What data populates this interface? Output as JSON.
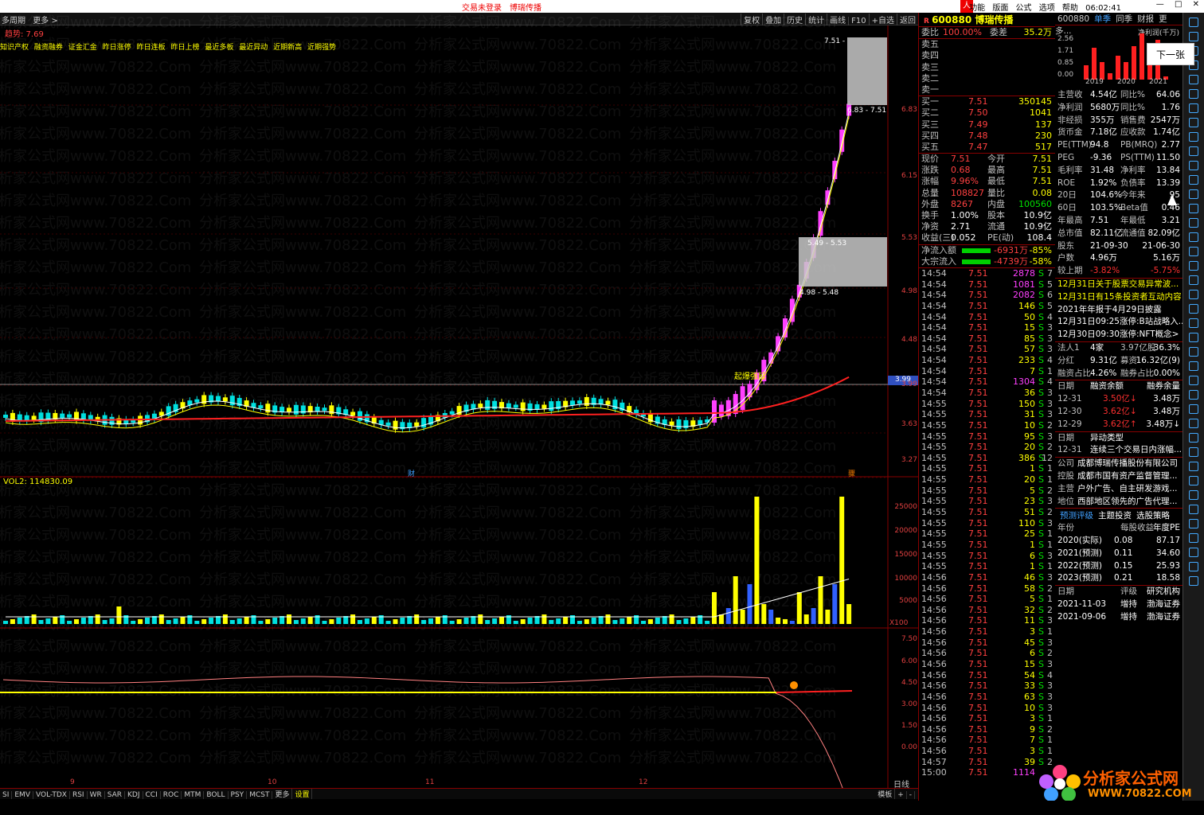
{
  "topbar": {
    "status": "交易未登录",
    "stock_name": "博瑞传播",
    "menu": [
      "功能",
      "版面",
      "公式",
      "选项",
      "帮助"
    ],
    "time": "06:02:41",
    "win_min": "—",
    "win_max": "□",
    "win_close": "✕"
  },
  "menurow": {
    "items": [
      "多周期",
      "更多 >"
    ],
    "trend_label": "趋势: 7.69",
    "tools": [
      "复权",
      "叠加",
      "历史",
      "统计",
      "画线",
      "F10",
      "+自选",
      "返回"
    ]
  },
  "tags": [
    "知识产权",
    "融资融券",
    "证金汇金",
    "昨日涨停",
    "昨日连板",
    "昨日上榜",
    "最近多板",
    "最近异动",
    "近期新高",
    "近期强势"
  ],
  "chart_labels": {
    "gap1": "7.51 -",
    "gap2": "6.83 - 7.51",
    "gap3": "5.49 - 5.53",
    "gap4": "4.98 - 5.48",
    "signal": "起爆强延",
    "cursor_price": "3.99",
    "vol_label": "VOL2: 114830.09",
    "x100": "X100",
    "finance_mark": "财",
    "news_mark": "骤",
    "dayline": "日线"
  },
  "price_axis": [
    "6.83",
    "6.15",
    "5.53",
    "4.98",
    "4.48",
    "3.99",
    "3.63",
    "3.27"
  ],
  "vol_axis": [
    "25000",
    "20000",
    "15000",
    "10000",
    "5000"
  ],
  "ind_axis": [
    "7.50",
    "6.00",
    "4.50",
    "3.00",
    "1.50",
    "0.00"
  ],
  "months": [
    "9",
    "10",
    "11",
    "12"
  ],
  "bottom_tabs": [
    "SI",
    "EMV",
    "VOL-TDX",
    "RSI",
    "WR",
    "SAR",
    "KDJ",
    "CCI",
    "ROC",
    "MTM",
    "BOLL",
    "PSY",
    "MCST",
    "更多",
    "设置"
  ],
  "bottom_right": [
    "模板",
    "+",
    "-"
  ],
  "quote": {
    "code": "600880",
    "name": "博瑞传播",
    "weibi": {
      "label": "委比",
      "value": "100.00%",
      "label2": "委差",
      "value2": "35.2万"
    },
    "sell": [
      {
        "l": "卖五",
        "p": "",
        "v": ""
      },
      {
        "l": "卖四",
        "p": "",
        "v": ""
      },
      {
        "l": "卖三",
        "p": "",
        "v": ""
      },
      {
        "l": "卖二",
        "p": "",
        "v": ""
      },
      {
        "l": "卖一",
        "p": "",
        "v": ""
      }
    ],
    "buy": [
      {
        "l": "买一",
        "p": "7.51",
        "v": "350145"
      },
      {
        "l": "买二",
        "p": "7.50",
        "v": "1041"
      },
      {
        "l": "买三",
        "p": "7.49",
        "v": "137"
      },
      {
        "l": "买四",
        "p": "7.48",
        "v": "230"
      },
      {
        "l": "买五",
        "p": "7.47",
        "v": "517"
      }
    ],
    "stats": [
      {
        "a": "现价",
        "b": "7.51",
        "c": "今开",
        "d": "7.51"
      },
      {
        "a": "涨跌",
        "b": "0.68",
        "c": "最高",
        "d": "7.51"
      },
      {
        "a": "涨幅",
        "b": "9.96%",
        "c": "最低",
        "d": "7.51"
      },
      {
        "a": "总量",
        "b": "108827",
        "c": "量比",
        "d": "0.08"
      },
      {
        "a": "外盘",
        "b": "8267",
        "c": "内盘",
        "d": "100560"
      },
      {
        "a": "换手",
        "b": "1.00%",
        "c": "股本",
        "d": "10.9亿"
      },
      {
        "a": "净资",
        "b": "2.71",
        "c": "流通",
        "d": "10.9亿"
      },
      {
        "a": "收益(三)",
        "b": "0.052",
        "c": "PE(动)",
        "d": "108.4"
      }
    ],
    "flows": [
      {
        "a": "净流入额",
        "b": "-6931万",
        "c": "-85%"
      },
      {
        "a": "大宗流入",
        "b": "-4739万",
        "c": "-58%"
      }
    ],
    "ticks": [
      {
        "t": "14:54",
        "p": "7.51",
        "v": "2878",
        "s": "S",
        "n": "7"
      },
      {
        "t": "14:54",
        "p": "7.51",
        "v": "1081",
        "s": "S",
        "n": "5"
      },
      {
        "t": "14:54",
        "p": "7.51",
        "v": "2082",
        "s": "S",
        "n": "6"
      },
      {
        "t": "14:54",
        "p": "7.51",
        "v": "146",
        "s": "S",
        "n": "5"
      },
      {
        "t": "14:54",
        "p": "7.51",
        "v": "50",
        "s": "S",
        "n": "4"
      },
      {
        "t": "14:54",
        "p": "7.51",
        "v": "15",
        "s": "S",
        "n": "3"
      },
      {
        "t": "14:54",
        "p": "7.51",
        "v": "85",
        "s": "S",
        "n": "3"
      },
      {
        "t": "14:54",
        "p": "7.51",
        "v": "57",
        "s": "S",
        "n": "3"
      },
      {
        "t": "14:54",
        "p": "7.51",
        "v": "233",
        "s": "S",
        "n": "4"
      },
      {
        "t": "14:54",
        "p": "7.51",
        "v": "7",
        "s": "S",
        "n": "1"
      },
      {
        "t": "14:54",
        "p": "7.51",
        "v": "1304",
        "s": "S",
        "n": "4"
      },
      {
        "t": "14:54",
        "p": "7.51",
        "v": "36",
        "s": "S",
        "n": "3"
      },
      {
        "t": "14:55",
        "p": "7.51",
        "v": "150",
        "s": "S",
        "n": "3"
      },
      {
        "t": "14:55",
        "p": "7.51",
        "v": "31",
        "s": "S",
        "n": "3"
      },
      {
        "t": "14:55",
        "p": "7.51",
        "v": "10",
        "s": "S",
        "n": "2"
      },
      {
        "t": "14:55",
        "p": "7.51",
        "v": "95",
        "s": "S",
        "n": "3"
      },
      {
        "t": "14:55",
        "p": "7.51",
        "v": "20",
        "s": "S",
        "n": "2"
      },
      {
        "t": "14:55",
        "p": "7.51",
        "v": "386",
        "s": "S",
        "n": "12"
      },
      {
        "t": "14:55",
        "p": "7.51",
        "v": "1",
        "s": "S",
        "n": "1"
      },
      {
        "t": "14:55",
        "p": "7.51",
        "v": "20",
        "s": "S",
        "n": "1"
      },
      {
        "t": "14:55",
        "p": "7.51",
        "v": "5",
        "s": "S",
        "n": "2"
      },
      {
        "t": "14:55",
        "p": "7.51",
        "v": "23",
        "s": "S",
        "n": "3"
      },
      {
        "t": "14:55",
        "p": "7.51",
        "v": "51",
        "s": "S",
        "n": "2"
      },
      {
        "t": "14:55",
        "p": "7.51",
        "v": "110",
        "s": "S",
        "n": "3"
      },
      {
        "t": "14:55",
        "p": "7.51",
        "v": "25",
        "s": "S",
        "n": "1"
      },
      {
        "t": "14:55",
        "p": "7.51",
        "v": "1",
        "s": "S",
        "n": "1"
      },
      {
        "t": "14:55",
        "p": "7.51",
        "v": "6",
        "s": "S",
        "n": "3"
      },
      {
        "t": "14:55",
        "p": "7.51",
        "v": "1",
        "s": "S",
        "n": "1"
      },
      {
        "t": "14:56",
        "p": "7.51",
        "v": "46",
        "s": "S",
        "n": "3"
      },
      {
        "t": "14:56",
        "p": "7.51",
        "v": "58",
        "s": "S",
        "n": "2"
      },
      {
        "t": "14:56",
        "p": "7.51",
        "v": "5",
        "s": "S",
        "n": "1"
      },
      {
        "t": "14:56",
        "p": "7.51",
        "v": "32",
        "s": "S",
        "n": "2"
      },
      {
        "t": "14:56",
        "p": "7.51",
        "v": "11",
        "s": "S",
        "n": "3"
      },
      {
        "t": "14:56",
        "p": "7.51",
        "v": "3",
        "s": "S",
        "n": "1"
      },
      {
        "t": "14:56",
        "p": "7.51",
        "v": "45",
        "s": "S",
        "n": "3"
      },
      {
        "t": "14:56",
        "p": "7.51",
        "v": "6",
        "s": "S",
        "n": "2"
      },
      {
        "t": "14:56",
        "p": "7.51",
        "v": "15",
        "s": "S",
        "n": "3"
      },
      {
        "t": "14:56",
        "p": "7.51",
        "v": "54",
        "s": "S",
        "n": "4"
      },
      {
        "t": "14:56",
        "p": "7.51",
        "v": "33",
        "s": "S",
        "n": "3"
      },
      {
        "t": "14:56",
        "p": "7.51",
        "v": "63",
        "s": "S",
        "n": "3"
      },
      {
        "t": "14:56",
        "p": "7.51",
        "v": "10",
        "s": "S",
        "n": "3"
      },
      {
        "t": "14:56",
        "p": "7.51",
        "v": "3",
        "s": "S",
        "n": "1"
      },
      {
        "t": "14:56",
        "p": "7.51",
        "v": "9",
        "s": "S",
        "n": "2"
      },
      {
        "t": "14:56",
        "p": "7.51",
        "v": "7",
        "s": "S",
        "n": "1"
      },
      {
        "t": "14:56",
        "p": "7.51",
        "v": "3",
        "s": "S",
        "n": "1"
      },
      {
        "t": "14:57",
        "p": "7.51",
        "v": "39",
        "s": "S",
        "n": "2"
      },
      {
        "t": "15:00",
        "p": "7.51",
        "v": "1114",
        "s": "",
        "n": ""
      }
    ]
  },
  "fin": {
    "head": [
      "600880",
      "单季",
      "同季",
      "财报",
      "更多..."
    ],
    "chart_label": "净利润(千万)",
    "chart_y": [
      "2.56",
      "1.71",
      "0.85",
      "0.00"
    ],
    "chart_years": [
      "2019",
      "2020",
      "2021"
    ],
    "rows1": [
      {
        "a": "主营收",
        "b": "4.54亿",
        "c": "同比%",
        "d": "64.06"
      },
      {
        "a": "净利润",
        "b": "5680万",
        "c": "同比%",
        "d": "1.76"
      },
      {
        "a": "非经损",
        "b": "355万",
        "c": "销售费",
        "d": "2547万"
      },
      {
        "a": "货币金",
        "b": "7.18亿",
        "c": "应收款",
        "d": "1.74亿"
      },
      {
        "a": "PE(TTM)",
        "b": "94.8",
        "c": "PB(MRQ)",
        "d": "2.77"
      },
      {
        "a": "PEG",
        "b": "-9.36",
        "c": "PS(TTM)",
        "d": "11.50"
      },
      {
        "a": "毛利率",
        "b": "31.48",
        "c": "净利率",
        "d": "13.84"
      },
      {
        "a": "ROE",
        "b": "1.92%",
        "c": "负债率",
        "d": "13.39"
      },
      {
        "a": "20日",
        "b": "104.6%",
        "c": "今年来",
        "d": "95"
      },
      {
        "a": "60日",
        "b": "103.5%",
        "c": "Beta值",
        "d": "0.46"
      },
      {
        "a": "年最高",
        "b": "7.51",
        "c": "年最低",
        "d": "3.21"
      },
      {
        "a": "总市值",
        "b": "82.11亿",
        "c": "流通值",
        "d": "82.09亿"
      },
      {
        "a": "股东",
        "b": "21-09-30",
        "c": "",
        "d": "21-06-30"
      },
      {
        "a": "户数",
        "b": "4.96万",
        "c": "",
        "d": "5.16万"
      },
      {
        "a": "较上期",
        "b": "-3.82%",
        "c": "",
        "d": "-5.75%"
      }
    ],
    "news": [
      "12月31日关于股票交易异常波...",
      "12月31日有15条投资者互动内容",
      "2021年年报于4月29日披露",
      "12月31日09:25涨停:B站战略入...",
      "12月30日09:30涨停:NFT概念>"
    ],
    "holder": {
      "a": "法人1",
      "b": "4家",
      "c": "3.97亿股",
      "d": "36.3%"
    },
    "div": {
      "a": "分红",
      "b": "9.31亿",
      "c": "募资",
      "d": "16.32亿(9)"
    },
    "margin": {
      "a": "融资占比",
      "b": "4.26%",
      "c": "融券占比",
      "d": "0.00%"
    },
    "margin_head": [
      "日期",
      "融资余额",
      "融券余量"
    ],
    "margin_rows": [
      [
        "12-31",
        "3.50亿↓",
        "3.48万"
      ],
      [
        "12-30",
        "3.62亿↓",
        "3.48万"
      ],
      [
        "12-29",
        "3.62亿↑",
        "3.48万↓"
      ]
    ],
    "abnormal_head": [
      "日期",
      "异动类型"
    ],
    "abnormal_row": [
      "12-31",
      "连续三个交易日内涨幅..."
    ],
    "company": [
      [
        "公司",
        "成都博瑞传播股份有限公司"
      ],
      [
        "控股",
        "成都市国有资产监督管理..."
      ],
      [
        "主营",
        "户外广告、自主研发游戏..."
      ],
      [
        "地位",
        "西部地区领先的广告代理..."
      ]
    ],
    "tabs": [
      "预测评级",
      "主题投资",
      "选股策略"
    ],
    "fc_head": [
      "年份",
      "每股收益",
      "年度PE"
    ],
    "fc_rows": [
      [
        "2020(实际)",
        "0.08",
        "87.17"
      ],
      [
        "2021(预测)",
        "0.11",
        "34.60"
      ],
      [
        "2022(预测)",
        "0.15",
        "25.93"
      ],
      [
        "2023(预测)",
        "0.21",
        "18.58"
      ]
    ],
    "rating_head": [
      "日期",
      "评级",
      "研究机构"
    ],
    "rating_rows": [
      [
        "2021-11-03",
        "增持",
        "渤海证券"
      ],
      [
        "2021-09-06",
        "增持",
        "渤海证券"
      ]
    ]
  },
  "tooltip": "下一张",
  "brand": {
    "line1": "分析家公式网",
    "line2": "WWW.70822.COM"
  },
  "watermark": "分析家公式网www.70822.Com"
}
